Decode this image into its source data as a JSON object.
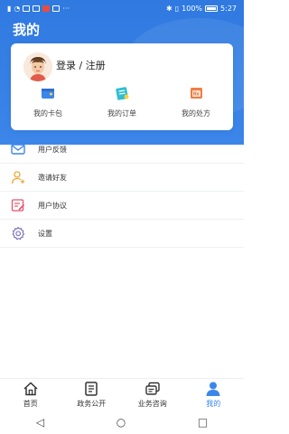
{
  "status": {
    "left_extra": "···",
    "right_text": "100% ",
    "time": "5:27"
  },
  "header": {
    "title": "我的"
  },
  "profile": {
    "login_label": "登录 / 注册",
    "shortcuts": [
      {
        "label": "我的卡包",
        "icon": "wallet-icon"
      },
      {
        "label": "我的订单",
        "icon": "order-icon"
      },
      {
        "label": "我的处方",
        "icon": "prescription-icon"
      }
    ]
  },
  "menu": [
    {
      "label": "用户反馈",
      "icon": "feedback-icon"
    },
    {
      "label": "邀请好友",
      "icon": "invite-friend-icon"
    },
    {
      "label": "用户协议",
      "icon": "agreement-icon"
    },
    {
      "label": "设置",
      "icon": "settings-icon"
    }
  ],
  "nav": [
    {
      "label": "首页",
      "icon": "home-icon"
    },
    {
      "label": "政务公开",
      "icon": "government-icon"
    },
    {
      "label": "业务咨询",
      "icon": "consult-icon"
    },
    {
      "label": "我的",
      "icon": "profile-icon"
    }
  ],
  "colors": {
    "primary": "#3b86ea",
    "header_bg": "#2f79e0"
  }
}
